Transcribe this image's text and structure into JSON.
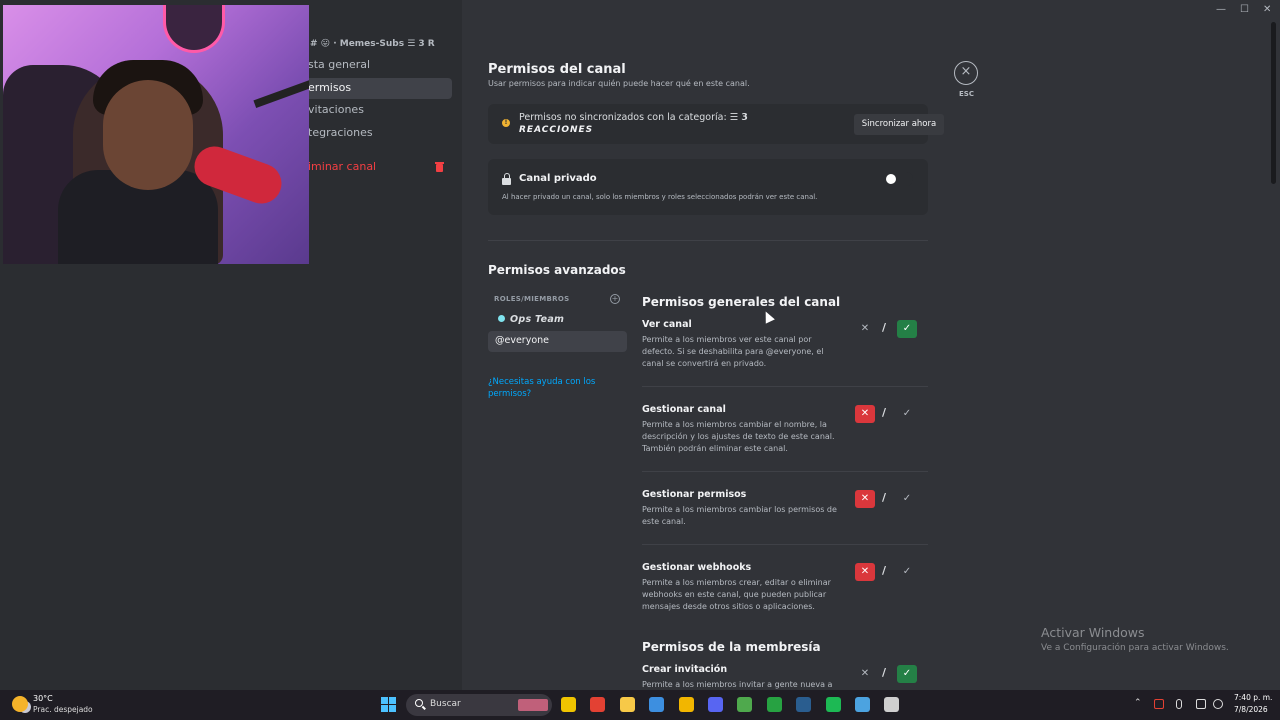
{
  "sidebar": {
    "header": "# 😛 · Memes-Subs ☰ 𝟯 R",
    "items": [
      {
        "label": "sta general"
      },
      {
        "label": "ermisos"
      },
      {
        "label": "vitaciones"
      },
      {
        "label": "tegraciones"
      },
      {
        "label": "iminar canal"
      }
    ]
  },
  "header": {
    "title": "Permisos del canal",
    "subtitle": "Usar permisos para indicar quién puede hacer qué en este canal.",
    "close_label": "×",
    "esc_label": "ESC"
  },
  "sync": {
    "text": "Permisos no sincronizados con la categoría: ☰   𝟯",
    "category": "REACCIONES",
    "button": "Sincronizar ahora",
    "icon": "!"
  },
  "private": {
    "title": "Canal privado",
    "description": "Al hacer privado un canal, solo los miembros y roles seleccionados podrán ver este canal.",
    "enabled": false
  },
  "advanced": {
    "title": "Permisos avanzados",
    "chevron": "⌄",
    "roles_header": "ROLES/MIEMBROS",
    "roles_add": "+",
    "roles": [
      {
        "label": "Ops Team",
        "color": "#7fe3ee"
      },
      {
        "label": "@everyone"
      }
    ],
    "help": "¿Necesitas ayuda con los permisos?"
  },
  "sections": [
    {
      "title": "Permisos generales del canal"
    },
    {
      "title": "Permisos de la membresía"
    }
  ],
  "permissions": [
    {
      "name": "Ver canal",
      "description": "Permite a los miembros ver este canal por defecto. Si se deshabilita para @everyone, el canal se convertirá en privado.",
      "state": "allow"
    },
    {
      "name": "Gestionar canal",
      "description": "Permite a los miembros cambiar el nombre, la descripción y los ajustes de texto de este canal. También podrán eliminar este canal.",
      "state": "deny"
    },
    {
      "name": "Gestionar permisos",
      "description": "Permite a los miembros cambiar los permisos de este canal.",
      "state": "deny"
    },
    {
      "name": "Gestionar webhooks",
      "description": "Permite a los miembros crear, editar o eliminar webhooks en este canal, que pueden publicar mensajes desde otros sitios o aplicaciones.",
      "state": "deny"
    },
    {
      "name": "Crear invitación",
      "description": "Permite a los miembros invitar a gente nueva a",
      "state": "allow"
    }
  ],
  "controls": {
    "deny": "✕",
    "slash": "/",
    "allow": "✓"
  },
  "watermark": {
    "title": "Activar Windows",
    "subtitle": "Ve a Configuración para activar Windows."
  },
  "window_controls": {
    "minimize": "—",
    "maximize": "☐",
    "close": "✕"
  },
  "taskbar": {
    "temperature": "30°C",
    "weather": "Prac. despejado",
    "search_label": "Buscar",
    "time": "7:40 p. m.",
    "date": "7/8/2026",
    "tray_up": "⌃",
    "apps": [
      {
        "name": "file-explorer-icon",
        "color": "#f0c400"
      },
      {
        "name": "chrome-icon",
        "color": "#e34133"
      },
      {
        "name": "folder-icon",
        "color": "#f7c948"
      },
      {
        "name": "store-icon",
        "color": "#3d8fe0"
      },
      {
        "name": "files-icon",
        "color": "#f2b600"
      },
      {
        "name": "discord-icon",
        "color": "#5865f2"
      },
      {
        "name": "chrome-alt-icon",
        "color": "#4fa94d"
      },
      {
        "name": "xbox-icon",
        "color": "#27a242"
      },
      {
        "name": "steam-icon",
        "color": "#2a5d8f"
      },
      {
        "name": "spotify-icon",
        "color": "#1db954"
      },
      {
        "name": "notepad-icon",
        "color": "#4ca3e0"
      },
      {
        "name": "obs-icon",
        "color": "#cfcfcf"
      }
    ]
  }
}
